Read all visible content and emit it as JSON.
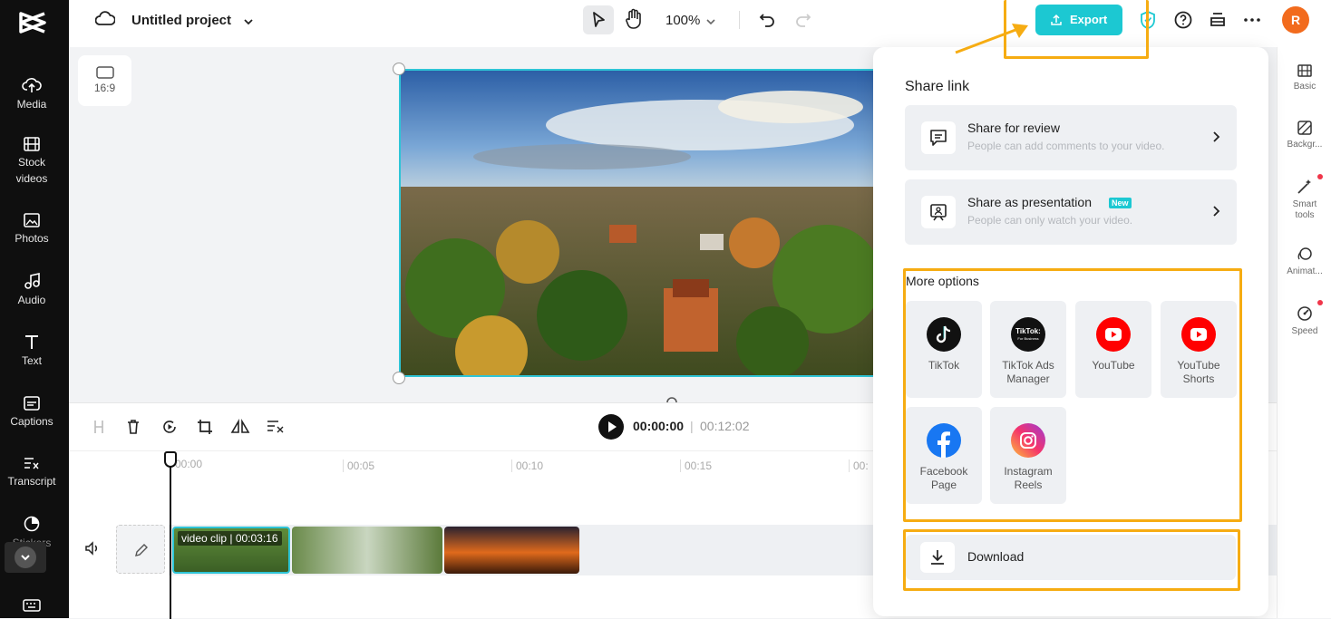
{
  "app": {
    "project_title": "Untitled project",
    "zoom": "100%",
    "avatar_initial": "R"
  },
  "left_rail": {
    "items": [
      {
        "label": "Media"
      },
      {
        "label": "Stock videos"
      },
      {
        "label": "Photos"
      },
      {
        "label": "Audio"
      },
      {
        "label": "Text"
      },
      {
        "label": "Captions"
      },
      {
        "label": "Transcript"
      },
      {
        "label": "Stickers"
      }
    ]
  },
  "canvas": {
    "aspect_label": "16:9"
  },
  "toolbar": {
    "export_label": "Export"
  },
  "timeline": {
    "current_time": "00:00:00",
    "separator": "|",
    "total_time": "00:12:02",
    "ruler": [
      "00:00",
      "00:05",
      "00:10",
      "00:15",
      "00:"
    ],
    "clip_label": "video clip | 00:03:16"
  },
  "right_rail": {
    "items": [
      {
        "label": "Basic"
      },
      {
        "label": "Backgr..."
      },
      {
        "label": "Smart tools"
      },
      {
        "label": "Animat..."
      },
      {
        "label": "Speed"
      }
    ]
  },
  "export_panel": {
    "share_link_title": "Share link",
    "share_for_review": {
      "title": "Share for review",
      "subtitle": "People can add comments to your video."
    },
    "share_as_presentation": {
      "title": "Share as presentation",
      "badge": "New",
      "subtitle": "People can only watch your video."
    },
    "more_options_title": "More options",
    "options": [
      {
        "label": "TikTok"
      },
      {
        "label": "TikTok Ads Manager"
      },
      {
        "label": "YouTube"
      },
      {
        "label": "YouTube Shorts"
      },
      {
        "label": "Facebook Page"
      },
      {
        "label": "Instagram Reels"
      }
    ],
    "tiktok_ads_logo_text": "TikTok:",
    "tiktok_ads_logo_sub": "For Business",
    "download_label": "Download"
  },
  "colors": {
    "accent": "#1cc8d2",
    "highlight": "#f6ac12",
    "avatar": "#f26b1d",
    "youtube": "#ff0000",
    "facebook": "#1877f2"
  }
}
